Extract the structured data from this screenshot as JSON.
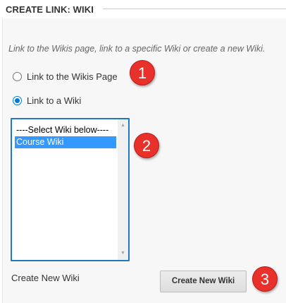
{
  "header": {
    "title": "CREATE LINK: WIKI"
  },
  "instructions": "Link to the Wikis page, link to a specific Wiki or create a new Wiki.",
  "radio_options": [
    {
      "label": "Link to the Wikis Page",
      "checked": false
    },
    {
      "label": "Link to a Wiki",
      "checked": true
    }
  ],
  "wiki_list": {
    "options": [
      "----Select Wiki below----",
      "Course Wiki"
    ],
    "selected_index": 1
  },
  "create_new": {
    "label": "Create New Wiki",
    "button_label": "Create New Wiki"
  },
  "callouts": [
    "1",
    "2",
    "3"
  ],
  "colors": {
    "accent": "#0078d7",
    "selection": "#3399ff",
    "listbox_border": "#1e78c2",
    "callout": "#e8312b",
    "panel_background": "#f7f7f7"
  }
}
